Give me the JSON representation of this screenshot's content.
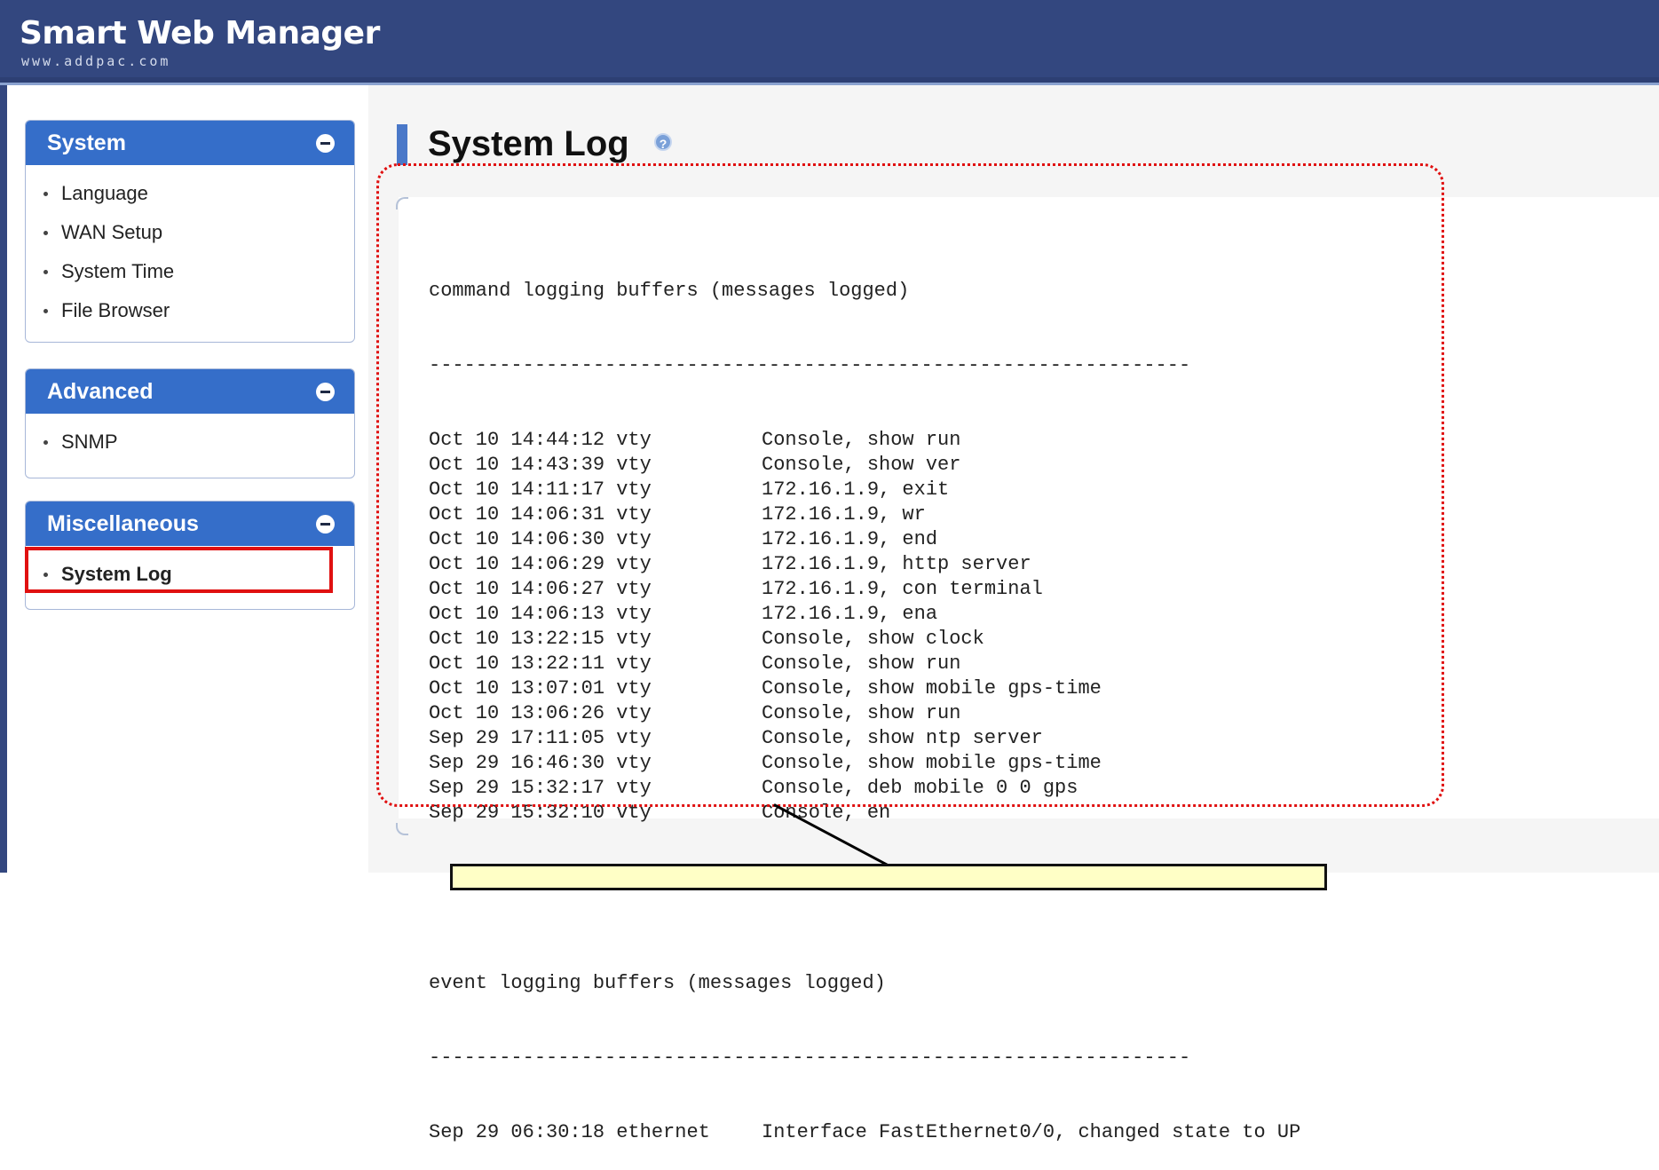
{
  "header": {
    "brand": "Smart Web Manager",
    "url": "www.addpac.com"
  },
  "sidebar": {
    "sections": [
      {
        "title": "System",
        "items": [
          "Language",
          "WAN Setup",
          "System Time",
          "File Browser"
        ]
      },
      {
        "title": "Advanced",
        "items": [
          "SNMP"
        ]
      },
      {
        "title": "Miscellaneous",
        "items": [
          "System Log"
        ]
      }
    ],
    "active_item": "System Log"
  },
  "page": {
    "title": "System Log",
    "help_icon": "?"
  },
  "log": {
    "command_header": "command logging buffers (messages logged)",
    "separator": "-----------------------------------------------------------------",
    "command_entries": [
      {
        "time": "Oct 10 14:44:12 vty",
        "message": "Console, show run"
      },
      {
        "time": "Oct 10 14:43:39 vty",
        "message": "Console, show ver"
      },
      {
        "time": "Oct 10 14:11:17 vty",
        "message": "172.16.1.9, exit"
      },
      {
        "time": "Oct 10 14:06:31 vty",
        "message": "172.16.1.9, wr"
      },
      {
        "time": "Oct 10 14:06:30 vty",
        "message": "172.16.1.9, end"
      },
      {
        "time": "Oct 10 14:06:29 vty",
        "message": "172.16.1.9, http server"
      },
      {
        "time": "Oct 10 14:06:27 vty",
        "message": "172.16.1.9, con terminal"
      },
      {
        "time": "Oct 10 14:06:13 vty",
        "message": "172.16.1.9, ena"
      },
      {
        "time": "Oct 10 13:22:15 vty",
        "message": "Console, show clock"
      },
      {
        "time": "Oct 10 13:22:11 vty",
        "message": "Console, show run"
      },
      {
        "time": "Oct 10 13:07:01 vty",
        "message": "Console, show mobile gps-time"
      },
      {
        "time": "Oct 10 13:06:26 vty",
        "message": "Console, show run"
      },
      {
        "time": "Sep 29 17:11:05 vty",
        "message": "Console, show ntp server"
      },
      {
        "time": "Sep 29 16:46:30 vty",
        "message": "Console, show mobile gps-time"
      },
      {
        "time": "Sep 29 15:32:17 vty",
        "message": "Console, deb mobile 0 0 gps"
      },
      {
        "time": "Sep 29 15:32:10 vty",
        "message": "Console, en"
      }
    ],
    "event_header": "event logging buffers (messages logged)",
    "event_entries": [
      {
        "time": "Sep 29 06:30:18 ethernet",
        "message": "Interface FastEthernet0/0, changed state to UP"
      }
    ]
  },
  "colors": {
    "header_bg": "#33477f",
    "section_header": "#356ec9",
    "highlight": "#e01010",
    "callout_bg": "#ffffc6"
  }
}
